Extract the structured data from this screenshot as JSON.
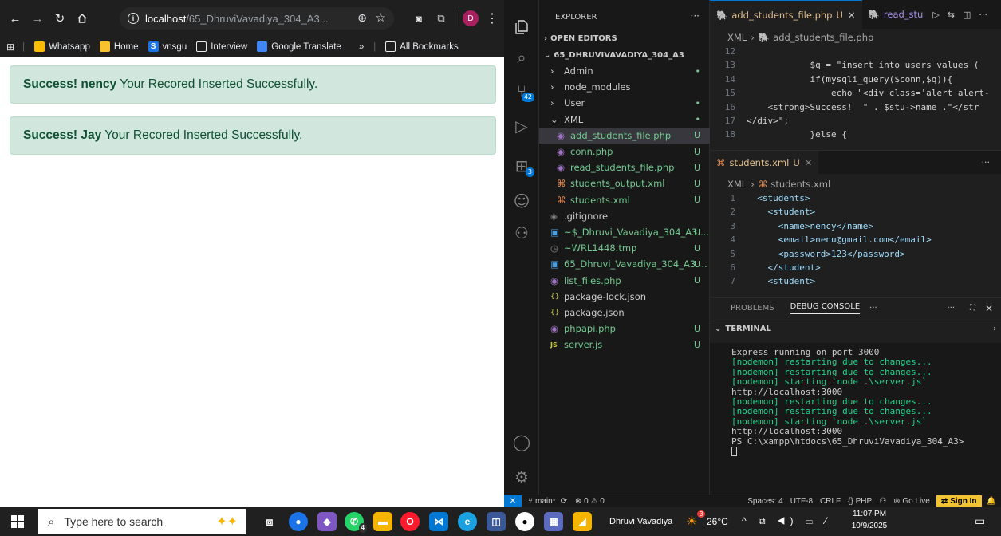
{
  "browser": {
    "url_host": "localhost",
    "url_path": "/65_DhruviVavadiya_304_A3...",
    "profile_initial": "D",
    "bookmarks": [
      "Whatsapp",
      "Home",
      "vnsgu",
      "Interview",
      "Google Translate"
    ],
    "more_bookmarks": "»",
    "all_bookmarks": "All Bookmarks",
    "alerts": [
      {
        "strong": "Success! nency",
        "text": "Your Recored Inserted Successfully."
      },
      {
        "strong": "Success! Jay",
        "text": "Your Recored Inserted Successfully."
      }
    ]
  },
  "vscode": {
    "explorer_title": "EXPLORER",
    "open_editors": "OPEN EDITORS",
    "root": "65_DHRUVIVAVADIYA_304_A3",
    "activity_badges": {
      "scm": "42",
      "extensions": "3"
    },
    "tree": [
      {
        "label": "Admin",
        "status": "•"
      },
      {
        "label": "node_modules",
        "status": ""
      },
      {
        "label": "User",
        "status": "•"
      },
      {
        "label": "XML",
        "status": "•"
      },
      {
        "label": "add_students_file.php",
        "status": "U"
      },
      {
        "label": "conn.php",
        "status": "U"
      },
      {
        "label": "read_students_file.php",
        "status": "U"
      },
      {
        "label": "students_output.xml",
        "status": "U"
      },
      {
        "label": "students.xml",
        "status": "U"
      },
      {
        "label": ".gitignore",
        "status": ""
      },
      {
        "label": "~$_Dhruvi_Vavadiya_304_A3....",
        "status": "U"
      },
      {
        "label": "~WRL1448.tmp",
        "status": "U"
      },
      {
        "label": "65_Dhruvi_Vavadiya_304_A3....",
        "status": "U"
      },
      {
        "label": "list_files.php",
        "status": "U"
      },
      {
        "label": "package-lock.json",
        "status": ""
      },
      {
        "label": "package.json",
        "status": ""
      },
      {
        "label": "phpapi.php",
        "status": "U"
      },
      {
        "label": "server.js",
        "status": "U"
      }
    ],
    "tab1": "add_students_file.php",
    "tab1_status": "U",
    "tab2": "read_stu",
    "crumb1_folder": "XML",
    "crumb1_file": "add_students_file.php",
    "php_lines": [
      {
        "n": "12",
        "code": ""
      },
      {
        "n": "13",
        "code": "            $q = \"insert into users values ("
      },
      {
        "n": "14",
        "code": "            if(mysqli_query($conn,$q)){"
      },
      {
        "n": "15",
        "code": "                echo \"<div class='alert alert-"
      },
      {
        "n": "16",
        "code": "    <strong>Success!  \" . $stu->name .\"</str"
      },
      {
        "n": "17",
        "code": "</div>\";"
      },
      {
        "n": "18",
        "code": "            }else {"
      }
    ],
    "tab3": "students.xml",
    "tab3_status": "U",
    "crumb2_folder": "XML",
    "crumb2_file": "students.xml",
    "xml_lines": [
      {
        "n": "1",
        "code": "  <students>"
      },
      {
        "n": "2",
        "code": "    <student>"
      },
      {
        "n": "3",
        "code": "      <name>nency</name>"
      },
      {
        "n": "4",
        "code": "      <email>nenu@gmail.com</email>"
      },
      {
        "n": "5",
        "code": "      <password>123</password>"
      },
      {
        "n": "6",
        "code": "    </student>"
      },
      {
        "n": "7",
        "code": "    <student>"
      }
    ],
    "panel_tabs": {
      "problems": "PROBLEMS",
      "debug": "DEBUG CONSOLE",
      "more": "···"
    },
    "terminal_title": "TERMINAL",
    "terminal_lines": [
      {
        "t": "Express running on port 3000",
        "c": "w"
      },
      {
        "t": "[nodemon] restarting due to changes...",
        "c": "g"
      },
      {
        "t": "[nodemon] restarting due to changes...",
        "c": "g"
      },
      {
        "t": "[nodemon] starting `node .\\server.js`",
        "c": "g"
      },
      {
        "t": "http://localhost:3000",
        "c": "w"
      },
      {
        "t": "[nodemon] restarting due to changes...",
        "c": "g"
      },
      {
        "t": "[nodemon] restarting due to changes...",
        "c": "g"
      },
      {
        "t": "[nodemon] starting `node .\\server.js`",
        "c": "g"
      },
      {
        "t": "http://localhost:3000",
        "c": "w"
      },
      {
        "t": "PS C:\\xampp\\htdocs\\65_DhruviVavadiya_304_A3>",
        "c": "w"
      }
    ],
    "status": {
      "branch": "main*",
      "problems": "⊗ 0 ⚠ 0",
      "spaces": "Spaces: 4",
      "encoding": "UTF-8",
      "eol": "CRLF",
      "lang": "{} PHP",
      "golive": "Go Live",
      "signin": "Sign In"
    }
  },
  "taskbar": {
    "search_placeholder": "Type here to search",
    "user": "Dhruvi Vavadiya",
    "weather": "26°C",
    "time": "11:07 PM",
    "date": "10/9/2025",
    "whatsapp_badge": "4",
    "weather_badge": "3"
  },
  "colors": {
    "alert_bg": "#d1e7dd",
    "alert_text": "#0f5132",
    "vscode_bg": "#181818",
    "accent": "#0078d4"
  }
}
